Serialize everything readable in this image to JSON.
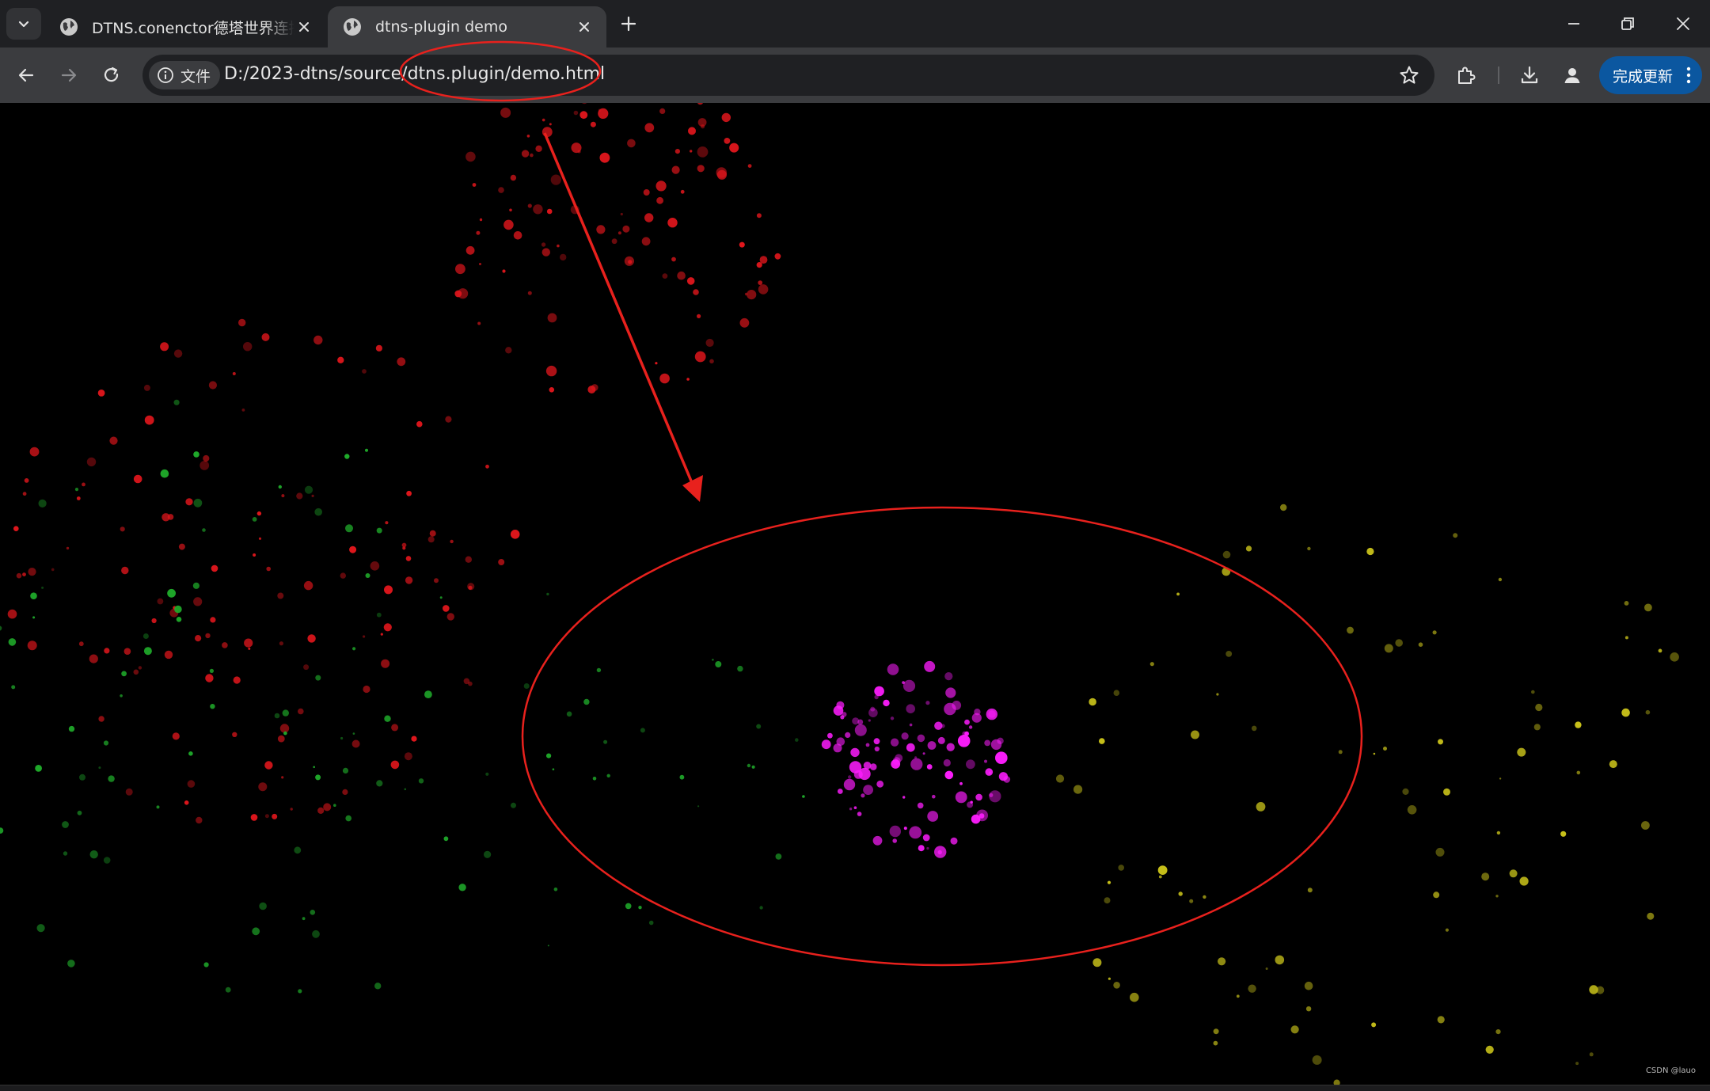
{
  "browser": {
    "tabs": [
      {
        "title": "DTNS.conenctor德塔世界连接",
        "active": false,
        "icon": "globe-icon"
      },
      {
        "title": "dtns-plugin demo",
        "active": true,
        "icon": "globe-icon"
      }
    ],
    "site_info": {
      "icon": "info-icon",
      "label": "文件"
    },
    "url": "D:/2023-dtns/source/dtns.plugin/demo.html",
    "update_button_label": "完成更新"
  },
  "page": {
    "watermark": "CSDN @lauo",
    "colors": {
      "background": "#000000",
      "red_cluster": "#e0161c",
      "green_cluster": "#1faa2a",
      "magenta_cluster": "#ff1dff",
      "yellow_cluster": "#c9c21a",
      "annotation": "#e8211d"
    },
    "annotations": [
      {
        "shape": "ellipse",
        "highlights": "url-plugin-name"
      },
      {
        "shape": "arrow",
        "points_to": "magenta-particle-cluster"
      },
      {
        "shape": "ellipse",
        "highlights": "magenta-particle-cluster"
      }
    ]
  }
}
